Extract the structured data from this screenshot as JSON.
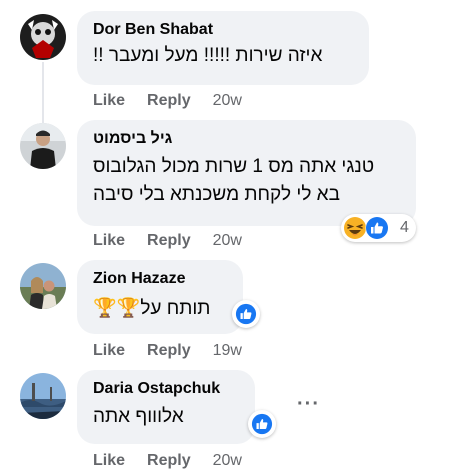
{
  "comments": [
    {
      "author": "Dor Ben Shabat",
      "text": "איזה שירות !!!!! מעל ומעבר !!",
      "like_label": "Like",
      "reply_label": "Reply",
      "time": "20w"
    },
    {
      "author": "גיל ביסמוט",
      "text_line1": "טנגי אתה מס 1 שרות מכול הגלובוס",
      "text_line2": "בא לי לקחת משכנתא בלי סיבה",
      "like_label": "Like",
      "reply_label": "Reply",
      "time": "20w",
      "reaction_count": "4",
      "reaction_icons": [
        "laughing-emoji",
        "like-thumb"
      ]
    },
    {
      "author": "Zion Hazaze",
      "text": "תותח על🏆🏆",
      "like_label": "Like",
      "reply_label": "Reply",
      "time": "19w",
      "reaction_icons": [
        "like-thumb"
      ]
    },
    {
      "author": "Daria Ostapchuk",
      "text": "אלוווף אתה",
      "like_label": "Like",
      "reply_label": "Reply",
      "time": "20w",
      "reaction_icons": [
        "like-thumb"
      ],
      "more_label": "···"
    }
  ],
  "colors": {
    "bubble": "#f0f2f5",
    "like_blue": "#1877f2",
    "meta_gray": "#65676b"
  }
}
